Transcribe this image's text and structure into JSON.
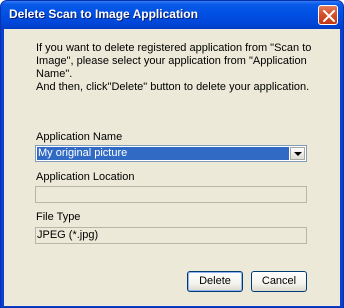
{
  "window": {
    "title": "Delete Scan to Image Application",
    "close_icon": "close-icon"
  },
  "message": {
    "line1": "If you want to delete registered application from \"Scan to",
    "line2": "Image\", please select your application from \"Application",
    "line3": "Name\".",
    "line4": "And then, click\"Delete\" button to delete your application."
  },
  "application_name": {
    "label": "Application Name",
    "selected": "My original picture"
  },
  "application_location": {
    "label": "Application Location",
    "value": ""
  },
  "file_type": {
    "label": "File Type",
    "value": "JPEG (*.jpg)"
  },
  "buttons": {
    "delete": "Delete",
    "cancel": "Cancel"
  },
  "colors": {
    "title_bar": "#0050e4",
    "dialog_face": "#ece9d8",
    "selection": "#316ac5",
    "close_button": "#d5502c"
  }
}
